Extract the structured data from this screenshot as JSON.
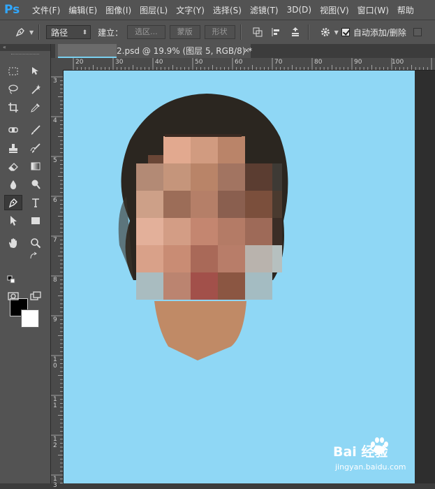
{
  "app": {
    "logo": "Ps"
  },
  "menubar": {
    "items": [
      "文件(F)",
      "编辑(E)",
      "图像(I)",
      "图层(L)",
      "文字(Y)",
      "选择(S)",
      "滤镜(T)",
      "3D(D)",
      "视图(V)",
      "窗口(W)",
      "帮助"
    ]
  },
  "options": {
    "mode_value": "路径",
    "build_label": "建立：",
    "selection_button": "选区...",
    "mask_button": "蒙版",
    "shape_button": "形状",
    "auto_add_delete_label": "自动添加/删除",
    "auto_add_delete_checked": true
  },
  "document_tab": {
    "title": "2.psd @ 19.9% (图层 5, RGB/8) *",
    "close": "×"
  },
  "ruler": {
    "top_labels": [
      "20",
      "30",
      "40",
      "50",
      "60",
      "70",
      "80",
      "90",
      "100"
    ],
    "left_labels": [
      "3",
      "4",
      "5",
      "6",
      "7",
      "8",
      "9",
      "10",
      "11",
      "12",
      "13"
    ]
  },
  "toolbox": {
    "collapse_label": "«"
  },
  "colors": {
    "foreground": "#000000",
    "background": "#ffffff",
    "canvas": "#8fd7f5",
    "accent": "#31a8ff"
  },
  "watermark": {
    "brand": "Bai  经验",
    "url": "jingyan.baidu.com"
  }
}
